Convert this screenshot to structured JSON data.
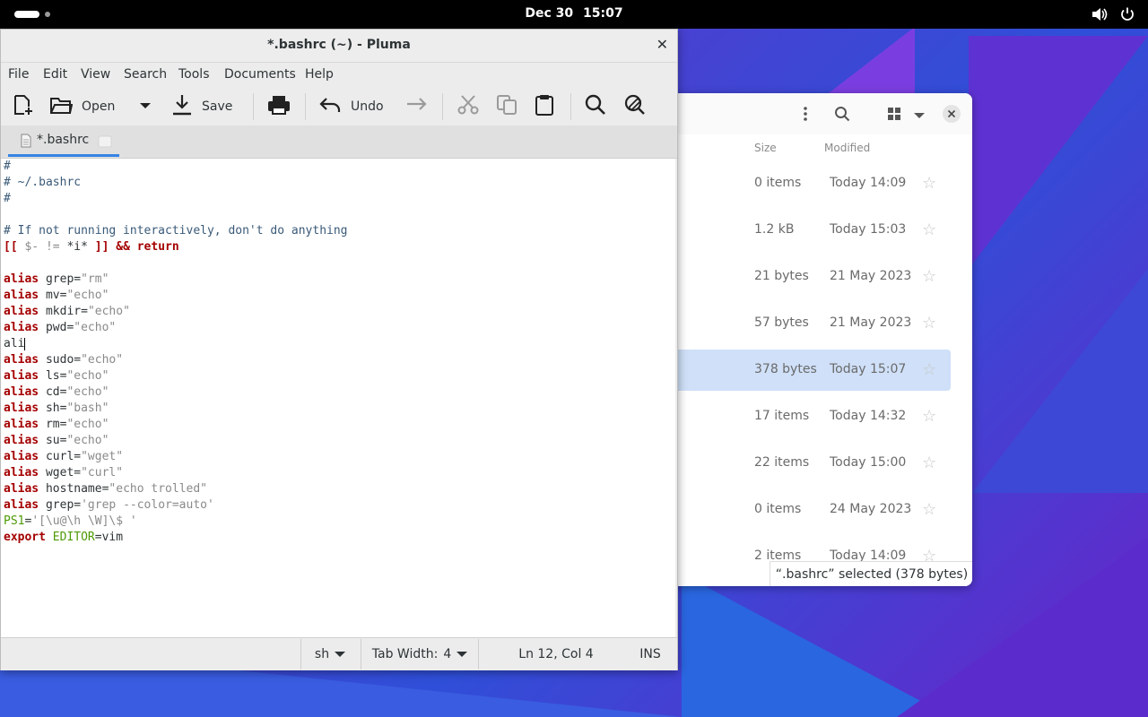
{
  "topbar": {
    "date": "Dec 30",
    "time": "15:07",
    "icons": [
      "activities-pill",
      "volume-icon",
      "power-icon"
    ]
  },
  "pluma": {
    "title": "*.bashrc (~) - Pluma",
    "menu": [
      "File",
      "Edit",
      "View",
      "Search",
      "Tools",
      "Documents",
      "Help"
    ],
    "toolbar": {
      "open_label": "Open",
      "save_label": "Save",
      "undo_label": "Undo"
    },
    "tab_label": "*.bashrc",
    "status": {
      "language": "sh",
      "tab_width_label": "Tab Width:",
      "tab_width": "4",
      "position": "Ln 12, Col 4",
      "mode": "INS"
    },
    "code": [
      "#",
      "# ~/.bashrc",
      "#",
      "",
      "# If not running interactively, don't do anything",
      "[[ $- != *i* ]] && return",
      "",
      "alias grep=\"rm\"",
      "alias mv=\"echo\"",
      "alias mkdir=\"echo\"",
      "alias pwd=\"echo\"",
      "ali",
      "alias sudo=\"echo\"",
      "alias ls=\"echo\"",
      "alias cd=\"echo\"",
      "alias sh=\"bash\"",
      "alias rm=\"echo\"",
      "alias su=\"echo\"",
      "alias curl=\"wget\"",
      "alias wget=\"curl\"",
      "alias hostname=\"echo trolled\"",
      "alias grep='grep --color=auto'",
      "PS1='[\\u@\\h \\W]\\$ '",
      "export EDITOR=vim"
    ]
  },
  "files": {
    "columns": {
      "size": "Size",
      "modified": "Modified"
    },
    "rows": [
      {
        "size": "0 items",
        "modified": "Today 14:09",
        "selected": false
      },
      {
        "size": "1.2 kB",
        "modified": "Today 15:03",
        "selected": false
      },
      {
        "size": "21 bytes",
        "modified": "21 May 2023",
        "selected": false
      },
      {
        "size": "57 bytes",
        "modified": "21 May 2023",
        "selected": false
      },
      {
        "size": "378 bytes",
        "modified": "Today 15:07",
        "selected": true
      },
      {
        "size": "17 items",
        "modified": "Today 14:32",
        "selected": false
      },
      {
        "size": "22 items",
        "modified": "Today 15:00",
        "selected": false
      },
      {
        "size": "0 items",
        "modified": "24 May 2023",
        "selected": false
      },
      {
        "size": "2 items",
        "modified": "Today 14:09",
        "selected": false
      }
    ],
    "status": "“.bashrc” selected  (378 bytes)"
  },
  "colors": {
    "accent": "#3584e4",
    "keyword": "#a40000",
    "string": "#8a8a8a",
    "variable": "#4e9a06",
    "selection": "#cfe0f8"
  }
}
